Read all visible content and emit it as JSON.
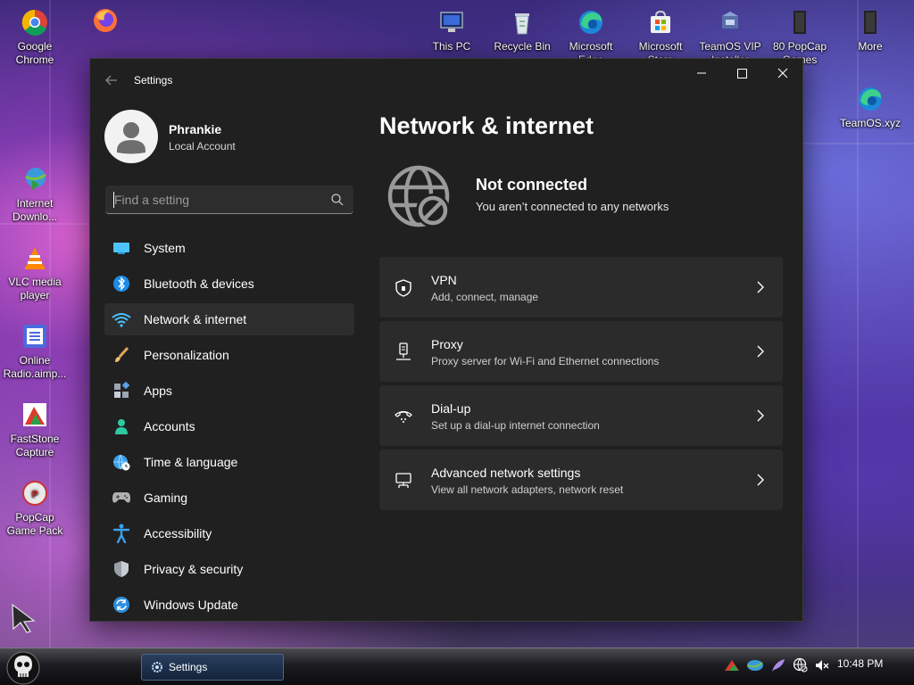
{
  "desktop": {
    "icons": [
      {
        "label": "Google Chrome",
        "icon": "chrome-icon"
      },
      {
        "label": "",
        "icon": "firefox-icon"
      },
      {
        "label": "This PC",
        "icon": "computer-icon"
      },
      {
        "label": "Recycle Bin",
        "icon": "recycle-bin-icon"
      },
      {
        "label": "Microsoft Edge",
        "icon": "edge-icon"
      },
      {
        "label": "Microsoft Store",
        "icon": "store-icon"
      },
      {
        "label": "TeamOS VIP Installer",
        "icon": "installer-icon"
      },
      {
        "label": "80 PopCap Games",
        "icon": "folder-icon"
      },
      {
        "label": "More",
        "icon": "folder-icon"
      },
      {
        "label": "TeamOS.xyz",
        "icon": "edge-icon"
      },
      {
        "label": "Internet Downlo...",
        "icon": "idm-icon"
      },
      {
        "label": "VLC media player",
        "icon": "vlc-icon"
      },
      {
        "label": "Online Radio.aimp...",
        "icon": "playlist-icon"
      },
      {
        "label": "FastStone Capture",
        "icon": "faststone-icon"
      },
      {
        "label": "PopCap Game Pack",
        "icon": "popcap-icon"
      }
    ]
  },
  "window": {
    "title": "Settings",
    "profile": {
      "name": "Phrankie",
      "type": "Local Account"
    },
    "search": {
      "placeholder": "Find a setting"
    },
    "nav": [
      {
        "label": "System",
        "icon": "monitor-icon",
        "color": "#4cc2ff"
      },
      {
        "label": "Bluetooth & devices",
        "icon": "bluetooth-icon",
        "color": "#1a8ce8"
      },
      {
        "label": "Network & internet",
        "icon": "wifi-icon",
        "color": "#4cc2ff",
        "selected": true
      },
      {
        "label": "Personalization",
        "icon": "brush-icon",
        "color": "#e8a45a"
      },
      {
        "label": "Apps",
        "icon": "apps-icon",
        "color": "#9aa4b2"
      },
      {
        "label": "Accounts",
        "icon": "person-icon",
        "color": "#2fc9a0"
      },
      {
        "label": "Time & language",
        "icon": "globe-clock-icon",
        "color": "#3aa0e8"
      },
      {
        "label": "Gaming",
        "icon": "gamepad-icon",
        "color": "#b0b0b0"
      },
      {
        "label": "Accessibility",
        "icon": "accessibility-icon",
        "color": "#3aa0e8"
      },
      {
        "label": "Privacy & security",
        "icon": "shield-icon",
        "color": "#9aa0a8"
      },
      {
        "label": "Windows Update",
        "icon": "update-icon",
        "color": "#2b8ee0"
      }
    ],
    "main": {
      "title": "Network & internet",
      "status": {
        "title": "Not connected",
        "subtitle": "You aren’t connected to any networks"
      },
      "cards": [
        {
          "title": "VPN",
          "subtitle": "Add, connect, manage",
          "icon": "vpn-shield-icon"
        },
        {
          "title": "Proxy",
          "subtitle": "Proxy server for Wi-Fi and Ethernet connections",
          "icon": "proxy-icon"
        },
        {
          "title": "Dial-up",
          "subtitle": "Set up a dial-up internet connection",
          "icon": "dialup-icon"
        },
        {
          "title": "Advanced network settings",
          "subtitle": "View all network adapters, network reset",
          "icon": "network-adapter-icon"
        }
      ]
    }
  },
  "taskbar": {
    "task_label": "Settings",
    "clock": "10:48 PM"
  }
}
